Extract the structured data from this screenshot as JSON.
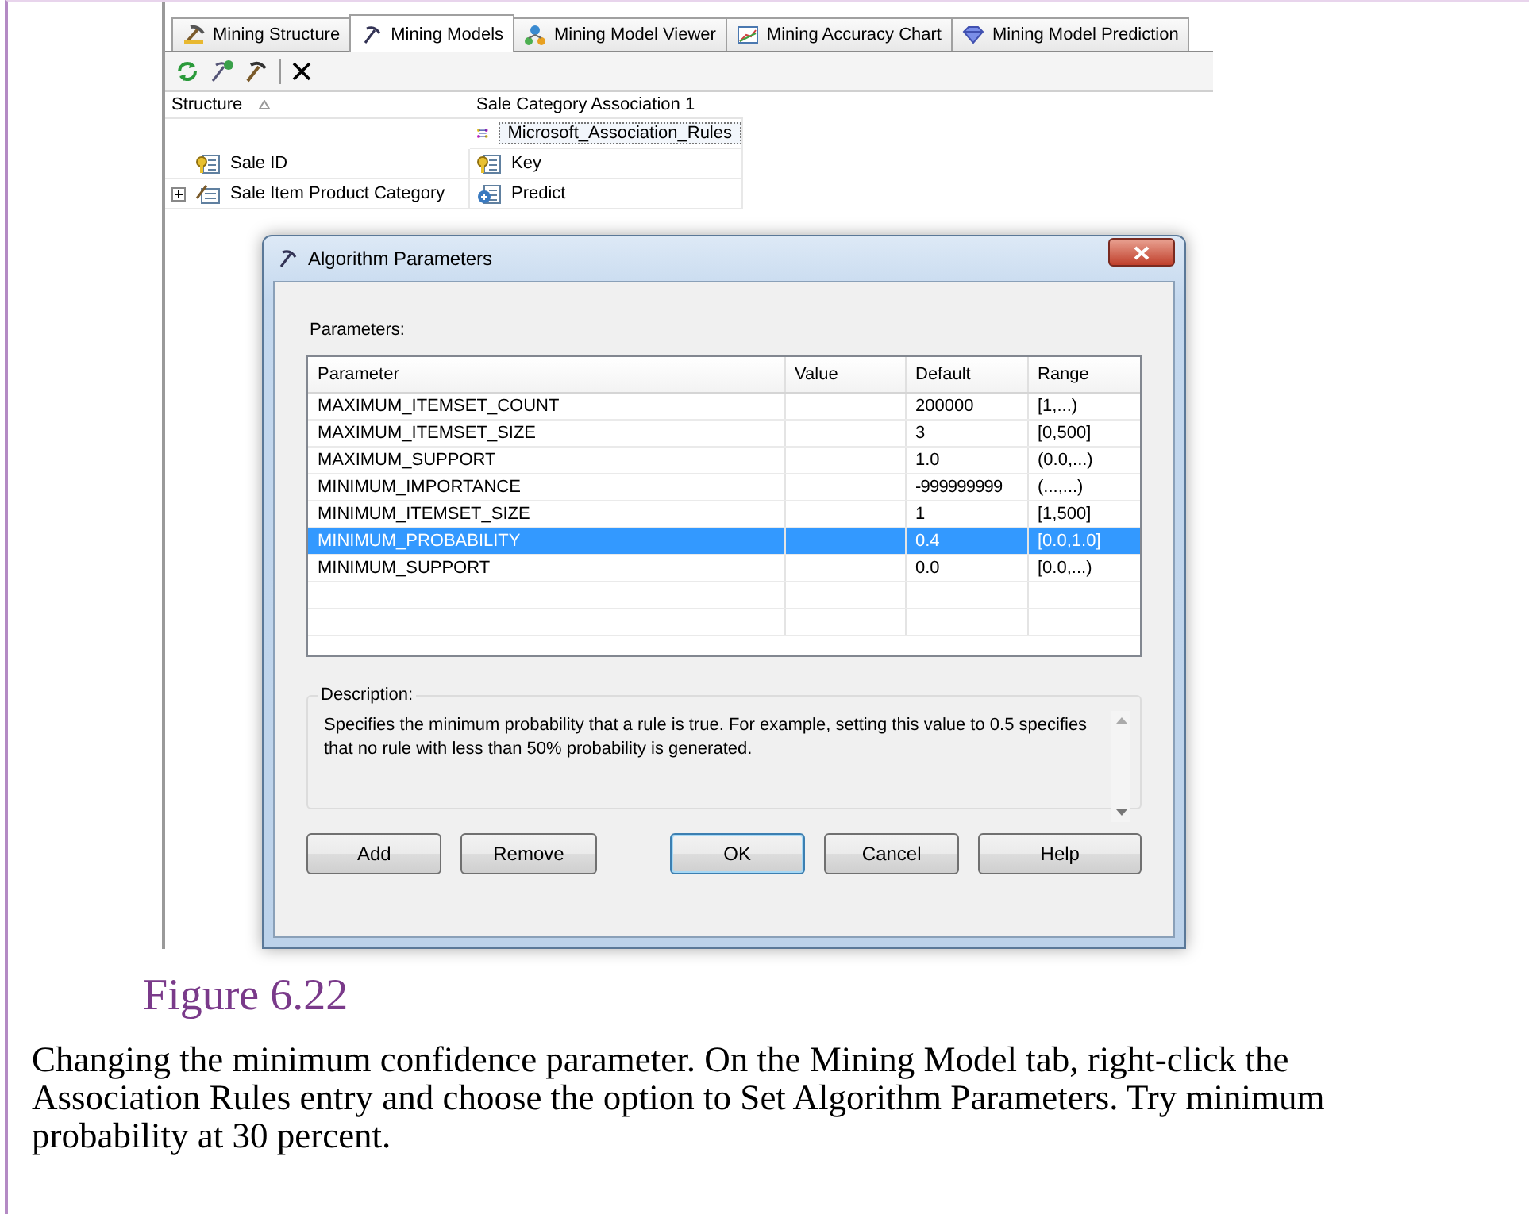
{
  "tabs": [
    {
      "label": "Mining Structure",
      "selected": false
    },
    {
      "label": "Mining Models",
      "selected": true
    },
    {
      "label": "Mining Model Viewer",
      "selected": false
    },
    {
      "label": "Mining Accuracy Chart",
      "selected": false
    },
    {
      "label": "Mining Model Prediction",
      "selected": false
    }
  ],
  "grid": {
    "columns": [
      "Structure",
      "Sale Category Association 1"
    ],
    "rows": [
      {
        "kind": "algorithm",
        "structure": "",
        "model": "Microsoft_Association_Rules"
      },
      {
        "kind": "key",
        "structure": "Sale ID",
        "model": "Key"
      },
      {
        "kind": "table",
        "structure": "Sale Item Product Category",
        "model": "Predict",
        "expanded": false
      }
    ]
  },
  "dialog": {
    "title": "Algorithm Parameters",
    "parameters_label": "Parameters:",
    "columns": [
      "Parameter",
      "Value",
      "Default",
      "Range"
    ],
    "rows": [
      {
        "parameter": "MAXIMUM_ITEMSET_COUNT",
        "value": "",
        "default": "200000",
        "range": "[1,...)",
        "selected": false
      },
      {
        "parameter": "MAXIMUM_ITEMSET_SIZE",
        "value": "",
        "default": "3",
        "range": "[0,500]",
        "selected": false
      },
      {
        "parameter": "MAXIMUM_SUPPORT",
        "value": "",
        "default": "1.0",
        "range": "(0.0,...)",
        "selected": false
      },
      {
        "parameter": "MINIMUM_IMPORTANCE",
        "value": "",
        "default": "-999999999",
        "range": "(...,...)",
        "selected": false
      },
      {
        "parameter": "MINIMUM_ITEMSET_SIZE",
        "value": "",
        "default": "1",
        "range": "[1,500]",
        "selected": false
      },
      {
        "parameter": "MINIMUM_PROBABILITY",
        "value": "",
        "default": "0.4",
        "range": "[0.0,1.0]",
        "selected": true
      },
      {
        "parameter": "MINIMUM_SUPPORT",
        "value": "",
        "default": "0.0",
        "range": "[0.0,...)",
        "selected": false
      }
    ],
    "description_label": "Description:",
    "description": "Specifies the minimum probability that a rule is true. For example, setting this value to 0.5 specifies that no rule with less than 50% probability is generated.",
    "buttons": [
      {
        "label": "Add",
        "default": false
      },
      {
        "label": "Remove",
        "default": false
      },
      {
        "label": "OK",
        "default": true
      },
      {
        "label": "Cancel",
        "default": false
      },
      {
        "label": "Help",
        "default": false
      }
    ]
  },
  "caption": {
    "figure": "Figure 6.22",
    "text": "Changing the minimum confidence parameter. On the Mining Model tab, right-click the Association Rules entry and choose the option to Set Algorithm Parameters. Try minimum probability at 30 percent."
  }
}
